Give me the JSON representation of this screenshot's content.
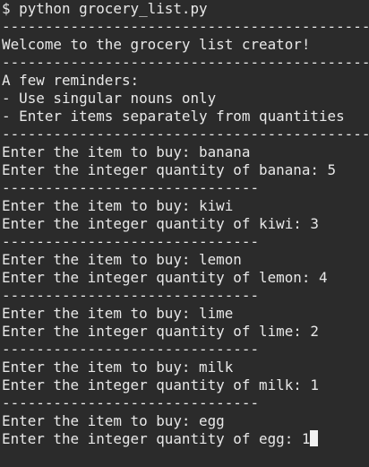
{
  "terminal": {
    "lines": [
      "$ python grocery_list.py",
      "-------------------------------------------",
      "Welcome to the grocery list creator!",
      "-------------------------------------------",
      "A few reminders:",
      "- Use singular nouns only",
      "- Enter items separately from quantities",
      "-------------------------------------------",
      "Enter the item to buy: banana",
      "Enter the integer quantity of banana: 5",
      "------------------------------",
      "Enter the item to buy: kiwi",
      "Enter the integer quantity of kiwi: 3",
      "------------------------------",
      "Enter the item to buy: lemon",
      "Enter the integer quantity of lemon: 4",
      "------------------------------",
      "Enter the item to buy: lime",
      "Enter the integer quantity of lime: 2",
      "------------------------------",
      "Enter the item to buy: milk",
      "Enter the integer quantity of milk: 1",
      "------------------------------",
      "Enter the item to buy: egg"
    ],
    "current_prompt": "Enter the integer quantity of egg: ",
    "current_input": "1"
  }
}
